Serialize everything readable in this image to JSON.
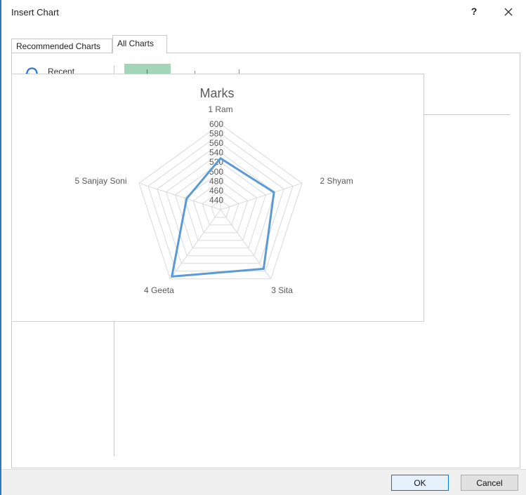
{
  "dialog": {
    "title": "Insert Chart",
    "help_label": "?"
  },
  "tabs": [
    {
      "label": "Recommended Charts",
      "active": false
    },
    {
      "label": "All Charts",
      "active": true
    }
  ],
  "sidebar": {
    "items": [
      {
        "label": "Recent",
        "icon": "recent-icon"
      }
    ]
  },
  "buttons": {
    "ok_label": "OK",
    "cancel_label": "Cancel"
  },
  "colors": {
    "series": "#5b9bd5",
    "accent_border": "#2b79c2",
    "thumbnail": "#a3d5b8"
  },
  "chart_data": {
    "type": "radar",
    "title": "Marks",
    "categories": [
      "1 Ram",
      "2 Shyam",
      "3 Sita",
      "4 Geeta",
      "5 Sanjay Soni"
    ],
    "series": [
      {
        "values": [
          528,
          538,
          574,
          594,
          495
        ]
      }
    ],
    "axis_ticks": [
      440,
      460,
      480,
      500,
      520,
      540,
      560,
      580,
      600
    ],
    "rmin": 420,
    "rmax": 600,
    "grid": true,
    "legend": "none"
  }
}
